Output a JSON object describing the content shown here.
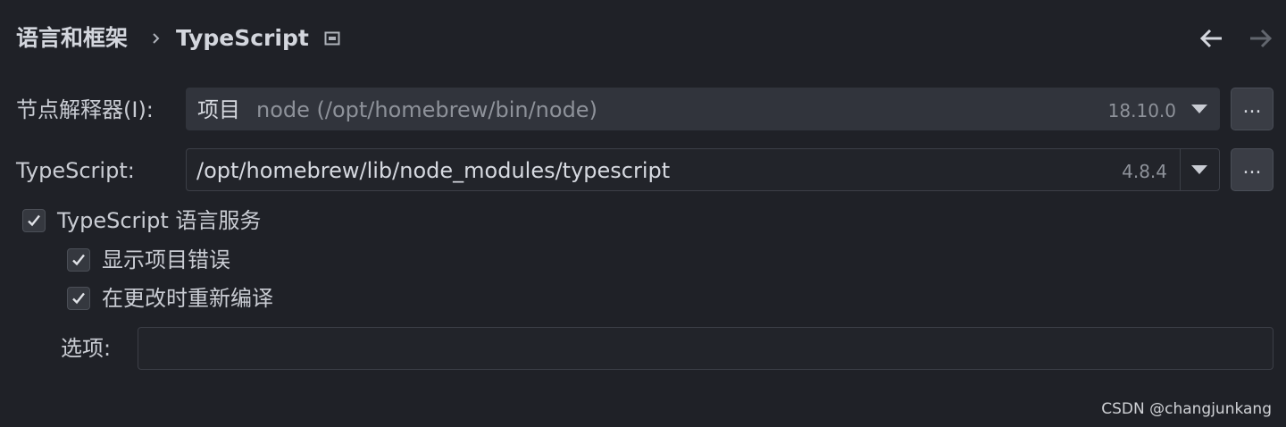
{
  "header": {
    "breadcrumb_parent": "语言和框架",
    "breadcrumb_current": "TypeScript",
    "icons": [
      "chevron-right-icon",
      "pin-icon",
      "back-arrow-icon",
      "forward-arrow-icon"
    ]
  },
  "node_interpreter": {
    "label": "节点解释器(I):",
    "scope": "项目",
    "path": "node (/opt/homebrew/bin/node)",
    "version": "18.10.0",
    "browse_label": "..."
  },
  "typescript": {
    "label": "TypeScript:",
    "path": "/opt/homebrew/lib/node_modules/typescript",
    "version": "4.8.4",
    "browse_label": "..."
  },
  "service": {
    "label": "TypeScript 语言服务",
    "checked": true,
    "show_project_errors": {
      "label": "显示项目错误",
      "checked": true
    },
    "recompile_on_change": {
      "label": "在更改时重新编译",
      "checked": true
    }
  },
  "options": {
    "label": "选项:",
    "value": ""
  },
  "watermark": "CSDN @changjunkang",
  "colors": {
    "background": "#1f2127",
    "field": "#31343c",
    "text": "#c9ccd3",
    "muted": "#8e929a"
  }
}
